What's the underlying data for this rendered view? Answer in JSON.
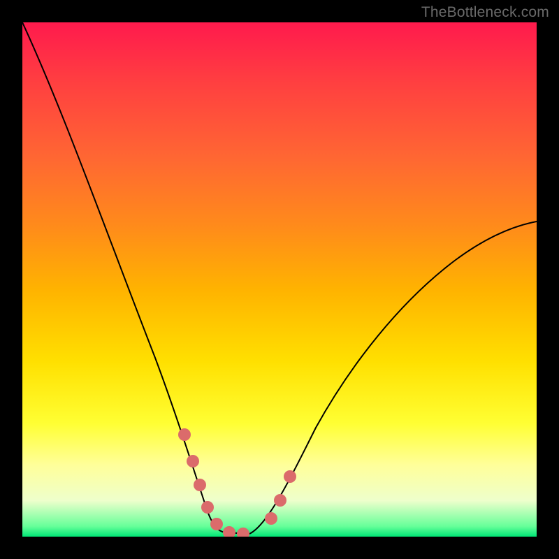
{
  "watermark": "TheBottleneck.com",
  "chart_data": {
    "type": "line",
    "title": "",
    "xlabel": "",
    "ylabel": "",
    "xlim": [
      0,
      100
    ],
    "ylim": [
      0,
      100
    ],
    "series": [
      {
        "name": "bottleneck-curve",
        "x": [
          0,
          5,
          10,
          15,
          20,
          25,
          28,
          30,
          32,
          34,
          36,
          38,
          40,
          43,
          47,
          52,
          58,
          65,
          73,
          82,
          92,
          100
        ],
        "y": [
          100,
          87,
          74,
          61,
          48,
          35,
          25,
          18,
          11,
          6,
          3,
          1,
          1,
          1,
          3,
          8,
          16,
          25,
          35,
          45,
          54,
          61
        ]
      }
    ],
    "markers": {
      "name": "highlight-dots",
      "color": "#e57373",
      "points_x": [
        28.5,
        30.5,
        32.0,
        34.0,
        36.5,
        38.5,
        41.0,
        46.0,
        47.5,
        49.5
      ],
      "points_y": [
        20,
        14,
        9,
        5,
        2,
        1,
        1,
        4,
        7,
        12
      ]
    }
  }
}
